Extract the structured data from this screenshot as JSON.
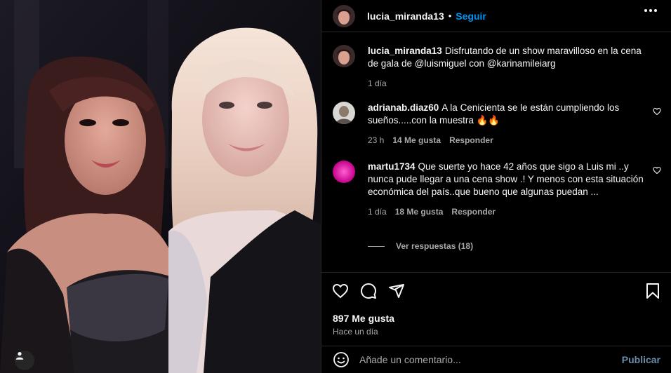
{
  "post": {
    "author": "lucia_miranda13",
    "separator": "•",
    "follow_label": "Seguir",
    "caption_text": "Disfrutando de un show maravilloso en la cena de gala de @luismiguel con @karinamileiarg",
    "caption_time": "1 día"
  },
  "comments": [
    {
      "user": "adrianab.diaz60",
      "text": "A la Cenicienta se le están cumpliendo los sueños.....con la muestra 🔥🔥",
      "time": "23 h",
      "likes": "14 Me gusta",
      "reply": "Responder"
    },
    {
      "user": "martu1734",
      "text": "Que suerte yo hace 42 años que sigo a Luis mi ..y nunca pude llegar a una cena show .! Y menos con esta situación económica del país..que bueno que algunas puedan ...",
      "time": "1 día",
      "likes": "18 Me gusta",
      "reply": "Responder"
    }
  ],
  "view_replies": "Ver respuestas (18)",
  "engagement": {
    "likes": "897 Me gusta",
    "time": "Hace un día"
  },
  "composer": {
    "placeholder": "Añade un comentario...",
    "publish_label": "Publicar"
  },
  "icons": {
    "header_more": "more-horizontal-icon",
    "like": "heart-icon",
    "comment": "comment-bubble-icon",
    "share": "paper-plane-icon",
    "save": "bookmark-icon",
    "emoji": "emoji-smile-icon",
    "tag": "user-tag-icon"
  },
  "colors": {
    "background": "#000000",
    "text": "#f5f5f5",
    "muted": "#a8a8a8",
    "accent": "#0095f6",
    "publish": "#6b8ca8",
    "border": "#262626"
  }
}
